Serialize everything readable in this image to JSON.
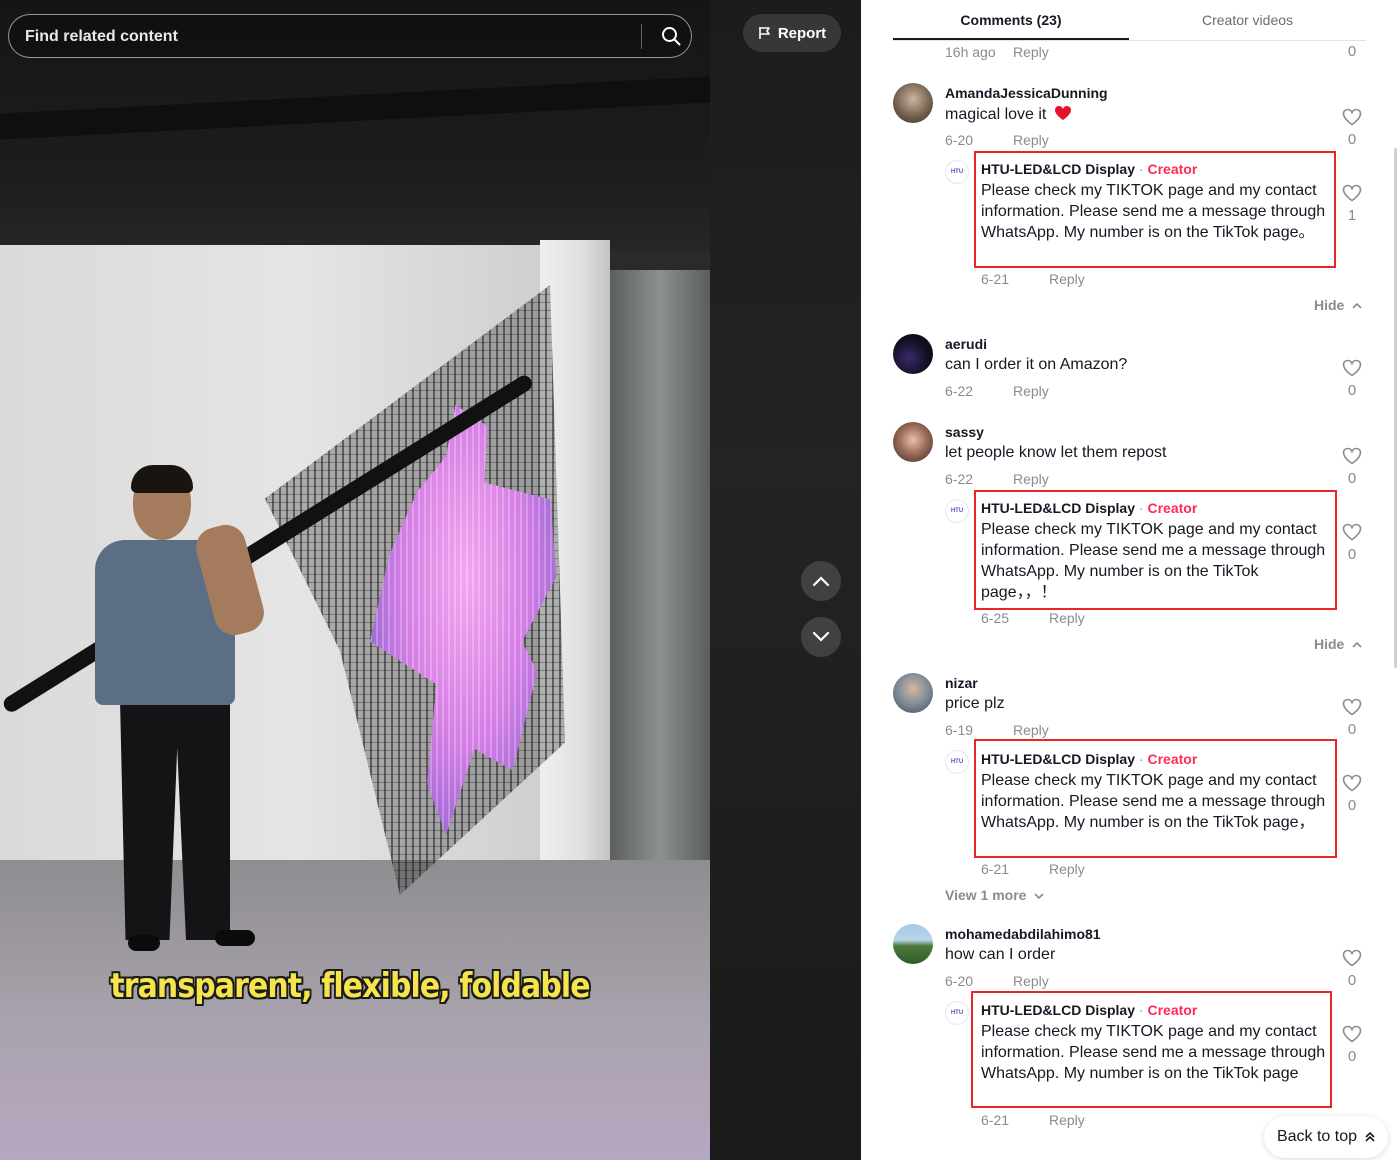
{
  "search": {
    "placeholder": "Find related content"
  },
  "report": {
    "label": "Report"
  },
  "video": {
    "caption": "transparent, flexible, foldable"
  },
  "tabs": [
    {
      "label": "Comments (23)",
      "active": true
    },
    {
      "label": "Creator videos",
      "active": false
    }
  ],
  "reply_label": "Reply",
  "hide_label": "Hide",
  "back_to_top": "Back to top",
  "colors": {
    "creator_accent": "#fe2c55",
    "highlight_border": "#e8262a"
  },
  "top_partial": {
    "date": "16h ago",
    "likes": "0"
  },
  "comments": [
    {
      "username": "AmandaJessicaDunning",
      "text": "magical love it",
      "emoji": "heart-emoji",
      "date": "6-20",
      "likes": "0",
      "reply": {
        "username": "HTU-LED&LCD Display",
        "badge": "Creator",
        "text": "Please check my TIKTOK page and my contact information. Please send me a message through WhatsApp. My number is on the TikTok page。",
        "date": "6-21",
        "likes": "1"
      }
    },
    {
      "username": "aerudi",
      "text": "can I order it on Amazon?",
      "date": "6-22",
      "likes": "0"
    },
    {
      "username": "sassy",
      "text": "let people know let them repost",
      "date": "6-22",
      "likes": "0",
      "reply": {
        "username": "HTU-LED&LCD Display",
        "badge": "Creator",
        "text": "Please check my TIKTOK page and my contact information. Please send me a message through WhatsApp. My number is on the TikTok page，，！",
        "date": "6-25",
        "likes": "0"
      }
    },
    {
      "username": "nizar",
      "text": "price plz",
      "date": "6-19",
      "likes": "0",
      "reply": {
        "username": "HTU-LED&LCD Display",
        "badge": "Creator",
        "text": "Please check my TIKTOK page and my contact information. Please send me a message through WhatsApp. My number is on the TikTok page，",
        "date": "6-21",
        "likes": "0"
      },
      "view_more": "View 1 more"
    },
    {
      "username": "mohamedabdilahimo81",
      "text": "how can I order",
      "date": "6-20",
      "likes": "0",
      "reply": {
        "username": "HTU-LED&LCD Display",
        "badge": "Creator",
        "text": "Please check my TIKTOK page and my contact information. Please send me a message through WhatsApp. My number is on the TikTok page",
        "date": "6-21",
        "likes": "0"
      }
    }
  ]
}
